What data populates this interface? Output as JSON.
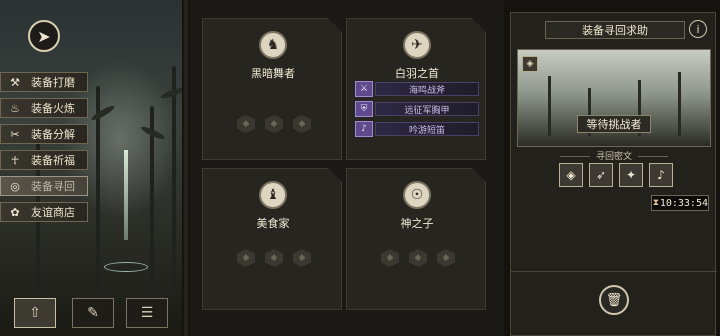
{
  "left_menu": {
    "items": [
      {
        "label": "装备打磨",
        "icon": "hammer-icon",
        "glyph": "⚒"
      },
      {
        "label": "装备火炼",
        "icon": "flame-icon",
        "glyph": "♨"
      },
      {
        "label": "装备分解",
        "icon": "break-icon",
        "glyph": "✂"
      },
      {
        "label": "装备祈福",
        "icon": "pray-icon",
        "glyph": "☥"
      },
      {
        "label": "装备寻回",
        "icon": "retrieve-icon",
        "glyph": "◎"
      },
      {
        "label": "友谊商店",
        "icon": "shop-icon",
        "glyph": "✿"
      }
    ],
    "active_index": 4
  },
  "bottom_buttons": [
    {
      "icon": "upgrade-icon",
      "glyph": "⇧"
    },
    {
      "icon": "feather-icon",
      "glyph": "✎"
    },
    {
      "icon": "list-icon",
      "glyph": "☰"
    }
  ],
  "cards": [
    {
      "name": "黑暗舞者",
      "avatar": "dancer-avatar-icon",
      "glyph": "♞",
      "slots": [
        "◆",
        "◆",
        "◆"
      ]
    },
    {
      "name": "白羽之首",
      "avatar": "feather-chief-avatar-icon",
      "glyph": "✈",
      "equipment": [
        {
          "label": "海鸣战斧",
          "glyph": "⚔"
        },
        {
          "label": "远征军胸甲",
          "glyph": "⛨"
        },
        {
          "label": "吟游短笛",
          "glyph": "♪"
        }
      ]
    },
    {
      "name": "美食家",
      "avatar": "gourmet-avatar-icon",
      "glyph": "♝",
      "slots": [
        "◆",
        "◆",
        "◆"
      ]
    },
    {
      "name": "神之子",
      "avatar": "divine-child-avatar-icon",
      "glyph": "☉",
      "slots": [
        "◆",
        "◆",
        "◆"
      ]
    }
  ],
  "right_panel": {
    "title": "装备寻回求助",
    "info_glyph": "i",
    "badge_glyph": "◈",
    "status": "等待挑战者",
    "runes_title": "寻回密文",
    "runes": [
      "◈",
      "➶",
      "✦",
      "♪"
    ],
    "timer": "10:33:54",
    "timer_glyph": "⧗",
    "trash_glyph": "🗑"
  },
  "colors": {
    "background": "#14130f",
    "panel": "#262520",
    "accent_purple": "#5e4a8c",
    "text_light": "#f2ead6"
  }
}
